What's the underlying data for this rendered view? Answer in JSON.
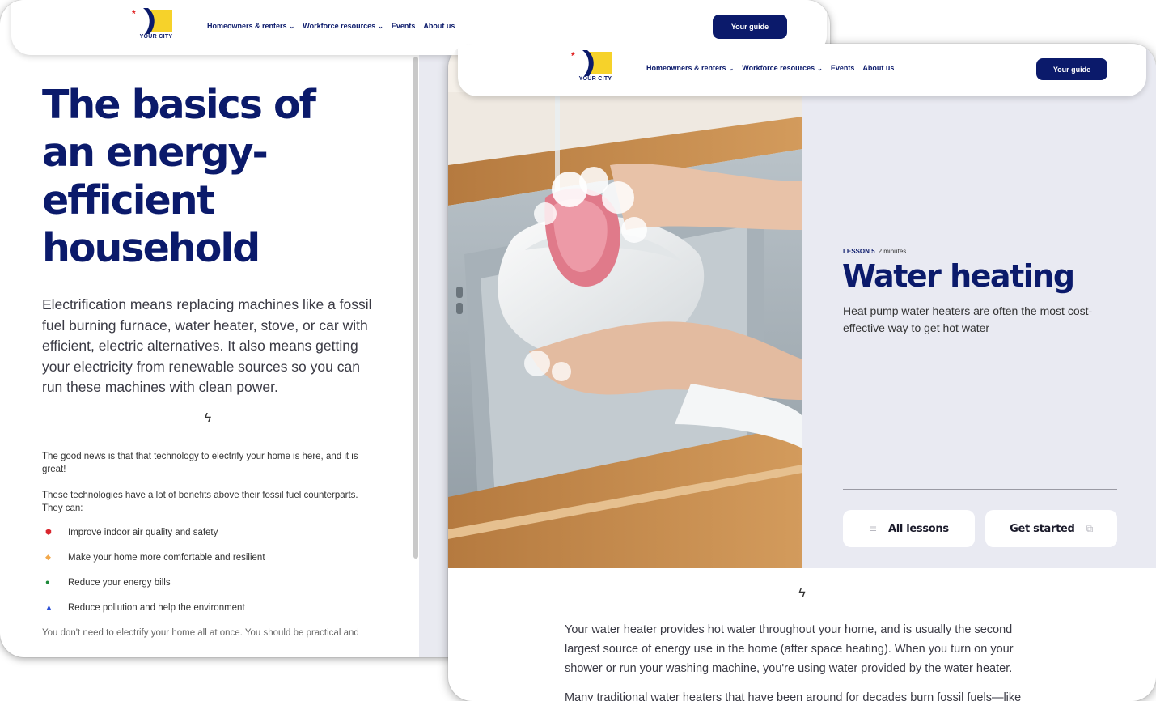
{
  "brand": {
    "logo_text": "YOUR CITY",
    "colors": {
      "navy": "#0b1a6b",
      "yellow": "#f6d22a",
      "red": "#e02020"
    }
  },
  "nav": {
    "items": [
      {
        "label": "Homeowners & renters",
        "has_dropdown": true
      },
      {
        "label": "Workforce resources",
        "has_dropdown": true
      },
      {
        "label": "Events",
        "has_dropdown": false
      },
      {
        "label": "About us",
        "has_dropdown": false
      }
    ],
    "guide_button": "Your guide"
  },
  "back_page": {
    "title": "The basics of an energy-efficient household",
    "lead": "Electrification means replacing machines like a fossil fuel burning furnace, water heater, stove, or car with efficient, electric alternatives. It also means getting your electricity from renewable sources so you can run these machines with clean power.",
    "divider_icon": "lightning-bolt-icon",
    "para1": "The good news is that that technology to electrify your home is here, and it is great!",
    "para2": "These technologies have a lot of benefits above their fossil fuel counterparts. They can:",
    "benefits": [
      {
        "icon": "shield-icon",
        "color": "#d9262e",
        "text": "Improve indoor air quality and safety"
      },
      {
        "icon": "home-icon",
        "color": "#f2a84b",
        "text": "Make your home more comfortable and resilient"
      },
      {
        "icon": "money-bag-icon",
        "color": "#1e8a3a",
        "text": "Reduce your energy bills"
      },
      {
        "icon": "flame-icon",
        "color": "#2b4fd6",
        "text": "Reduce pollution and help the environment"
      }
    ],
    "cut_off_text": "You don't need to electrify your home all at once. You should be practical and"
  },
  "front_page": {
    "lesson_label": "LESSON 5",
    "duration": "2 minutes",
    "title": "Water heating",
    "subtitle": "Heat pump water heaters are often the most cost-effective way to get hot water",
    "buttons": {
      "all_lessons": "All lessons",
      "get_started": "Get started"
    },
    "divider_icon": "lightning-bolt-icon",
    "body": "Your water heater provides hot water throughout your home, and is usually the second largest source of energy use in the home (after space heating). When you turn on your shower or run your washing machine, you're using water provided by the water heater.",
    "body_cut": "Many traditional water heaters that have been around for decades burn fossil fuels—like"
  }
}
